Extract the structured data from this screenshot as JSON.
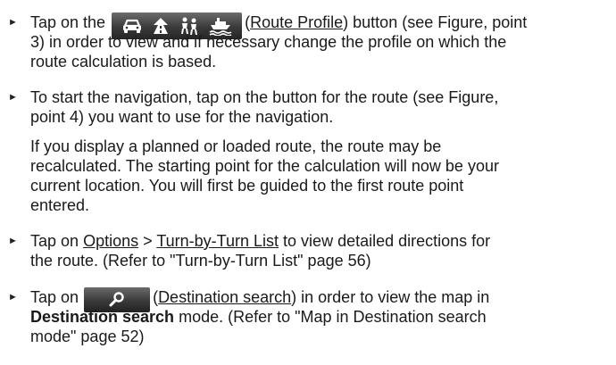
{
  "bullet_glyph": "►",
  "item1": {
    "tap_on_the": "Tap on the",
    "button_name": "Route Profile",
    "line1_rest": "button (see Figure, point",
    "line2": "3) in order to view and if necessary change the profile on which the",
    "line3": "route calculation is based.",
    "icons": [
      "car-icon",
      "highway-icon",
      "pedestrian-icon",
      "ferry-icon"
    ]
  },
  "item2": {
    "line1": "To start the navigation, tap on the button for the route (see Figure,",
    "line2": "point 4) you want to use for the navigation.",
    "note_line1": "If you display a planned or loaded route, the route may be",
    "note_line2": "recalculated. The starting point for the calculation will now be your",
    "note_line3": "current location. You will first be guided to the first route point",
    "note_line4": "entered."
  },
  "item3": {
    "tap_on": "Tap on",
    "options": "Options",
    "separator": ">",
    "turn_list": "Turn-by-Turn List",
    "line1_rest": "to view detailed directions for",
    "line2": "the route. (Refer to \"Turn-by-Turn List\" page 56)"
  },
  "item4": {
    "tap_on": "Tap on",
    "button_name": "Destination search",
    "line1_rest": "in order to view the map in",
    "bold_mode": "Destination search",
    "line2_rest": "mode. (Refer to \"Map in Destination search",
    "line3": "mode\" page 52)",
    "icon": "search-icon"
  }
}
